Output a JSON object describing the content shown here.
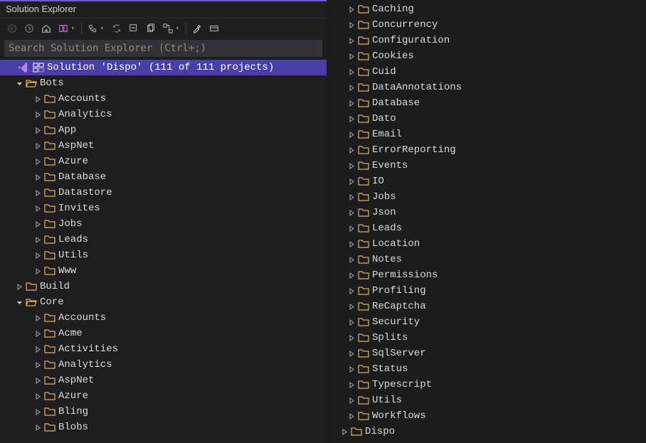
{
  "title": "Solution Explorer",
  "search_placeholder": "Search Solution Explorer (Ctrl+;)",
  "solution_label": "Solution 'Dispo' (111 of 111 projects)",
  "left_tree": [
    {
      "depth": 0,
      "expander": "none",
      "icon": "solution",
      "label_key": "solution_label",
      "selected": true
    },
    {
      "depth": 1,
      "expander": "open",
      "icon": "folder-open",
      "label": "Bots"
    },
    {
      "depth": 2,
      "expander": "closed",
      "icon": "folder",
      "label": "Accounts"
    },
    {
      "depth": 2,
      "expander": "closed",
      "icon": "folder",
      "label": "Analytics"
    },
    {
      "depth": 2,
      "expander": "closed",
      "icon": "folder",
      "label": "App"
    },
    {
      "depth": 2,
      "expander": "closed",
      "icon": "folder",
      "label": "AspNet"
    },
    {
      "depth": 2,
      "expander": "closed",
      "icon": "folder",
      "label": "Azure"
    },
    {
      "depth": 2,
      "expander": "closed",
      "icon": "folder",
      "label": "Database"
    },
    {
      "depth": 2,
      "expander": "closed",
      "icon": "folder",
      "label": "Datastore"
    },
    {
      "depth": 2,
      "expander": "closed",
      "icon": "folder",
      "label": "Invites"
    },
    {
      "depth": 2,
      "expander": "closed",
      "icon": "folder",
      "label": "Jobs"
    },
    {
      "depth": 2,
      "expander": "closed",
      "icon": "folder",
      "label": "Leads"
    },
    {
      "depth": 2,
      "expander": "closed",
      "icon": "folder",
      "label": "Utils"
    },
    {
      "depth": 2,
      "expander": "closed",
      "icon": "folder",
      "label": "Www"
    },
    {
      "depth": 1,
      "expander": "closed",
      "icon": "folder",
      "label": "Build"
    },
    {
      "depth": 1,
      "expander": "open",
      "icon": "folder-open",
      "label": "Core"
    },
    {
      "depth": 2,
      "expander": "closed",
      "icon": "folder",
      "label": "Accounts"
    },
    {
      "depth": 2,
      "expander": "closed",
      "icon": "folder",
      "label": "Acme"
    },
    {
      "depth": 2,
      "expander": "closed",
      "icon": "folder",
      "label": "Activities"
    },
    {
      "depth": 2,
      "expander": "closed",
      "icon": "folder",
      "label": "Analytics"
    },
    {
      "depth": 2,
      "expander": "closed",
      "icon": "folder",
      "label": "AspNet"
    },
    {
      "depth": 2,
      "expander": "closed",
      "icon": "folder",
      "label": "Azure"
    },
    {
      "depth": 2,
      "expander": "closed",
      "icon": "folder",
      "label": "Bling"
    },
    {
      "depth": 2,
      "expander": "closed",
      "icon": "folder",
      "label": "Blobs"
    }
  ],
  "right_tree": [
    {
      "depth": 2,
      "expander": "closed",
      "icon": "folder",
      "label": "Caching"
    },
    {
      "depth": 2,
      "expander": "closed",
      "icon": "folder",
      "label": "Concurrency"
    },
    {
      "depth": 2,
      "expander": "closed",
      "icon": "folder",
      "label": "Configuration"
    },
    {
      "depth": 2,
      "expander": "closed",
      "icon": "folder",
      "label": "Cookies"
    },
    {
      "depth": 2,
      "expander": "closed",
      "icon": "folder",
      "label": "Cuid"
    },
    {
      "depth": 2,
      "expander": "closed",
      "icon": "folder",
      "label": "DataAnnotations"
    },
    {
      "depth": 2,
      "expander": "closed",
      "icon": "folder",
      "label": "Database"
    },
    {
      "depth": 2,
      "expander": "closed",
      "icon": "folder",
      "label": "Dato"
    },
    {
      "depth": 2,
      "expander": "closed",
      "icon": "folder",
      "label": "Email"
    },
    {
      "depth": 2,
      "expander": "closed",
      "icon": "folder",
      "label": "ErrorReporting"
    },
    {
      "depth": 2,
      "expander": "closed",
      "icon": "folder",
      "label": "Events"
    },
    {
      "depth": 2,
      "expander": "closed",
      "icon": "folder",
      "label": "IO"
    },
    {
      "depth": 2,
      "expander": "closed",
      "icon": "folder",
      "label": "Jobs"
    },
    {
      "depth": 2,
      "expander": "closed",
      "icon": "folder",
      "label": "Json"
    },
    {
      "depth": 2,
      "expander": "closed",
      "icon": "folder",
      "label": "Leads"
    },
    {
      "depth": 2,
      "expander": "closed",
      "icon": "folder",
      "label": "Location"
    },
    {
      "depth": 2,
      "expander": "closed",
      "icon": "folder",
      "label": "Notes"
    },
    {
      "depth": 2,
      "expander": "closed",
      "icon": "folder",
      "label": "Permissions"
    },
    {
      "depth": 2,
      "expander": "closed",
      "icon": "folder",
      "label": "Profiling"
    },
    {
      "depth": 2,
      "expander": "closed",
      "icon": "folder",
      "label": "ReCaptcha"
    },
    {
      "depth": 2,
      "expander": "closed",
      "icon": "folder",
      "label": "Security"
    },
    {
      "depth": 2,
      "expander": "closed",
      "icon": "folder",
      "label": "Splits"
    },
    {
      "depth": 2,
      "expander": "closed",
      "icon": "folder",
      "label": "SqlServer"
    },
    {
      "depth": 2,
      "expander": "closed",
      "icon": "folder",
      "label": "Status"
    },
    {
      "depth": 2,
      "expander": "closed",
      "icon": "folder",
      "label": "Typescript"
    },
    {
      "depth": 2,
      "expander": "closed",
      "icon": "folder",
      "label": "Utils"
    },
    {
      "depth": 2,
      "expander": "closed",
      "icon": "folder",
      "label": "Workflows"
    },
    {
      "depth": 1,
      "expander": "closed",
      "icon": "folder",
      "label": "Dispo"
    }
  ]
}
